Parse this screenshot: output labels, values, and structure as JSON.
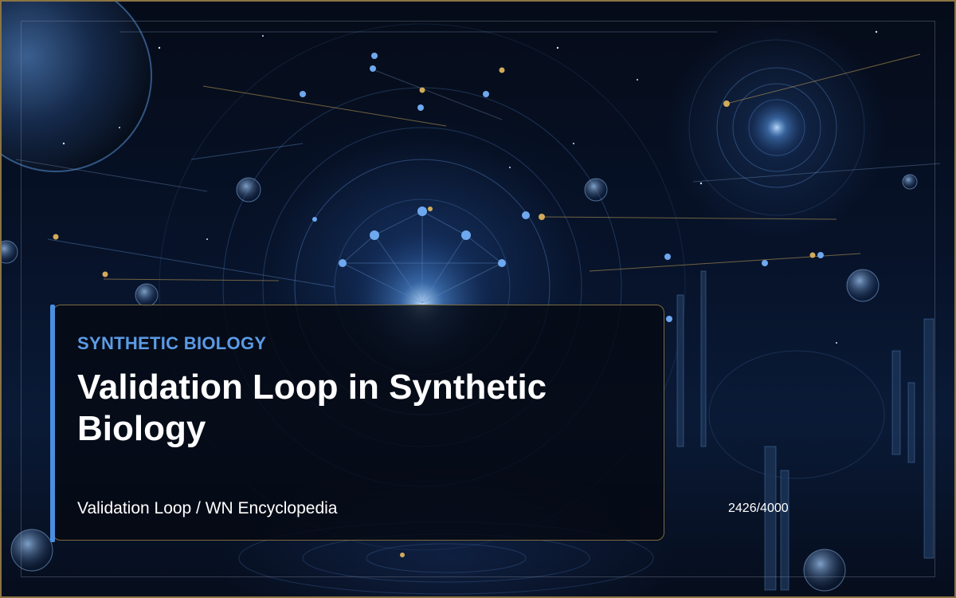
{
  "card": {
    "category": "SYNTHETIC BIOLOGY",
    "title": "Validation Loop in Synthetic Biology",
    "subtitle": "Validation Loop / WN Encyclopedia"
  },
  "counter": "2426/4000",
  "colors": {
    "frame": "#8a7443",
    "accent": "#4a8ee0",
    "category_text": "#5b9be6",
    "background": "#07132a"
  },
  "background_image": "sci-fi-cosmic-network-artwork"
}
